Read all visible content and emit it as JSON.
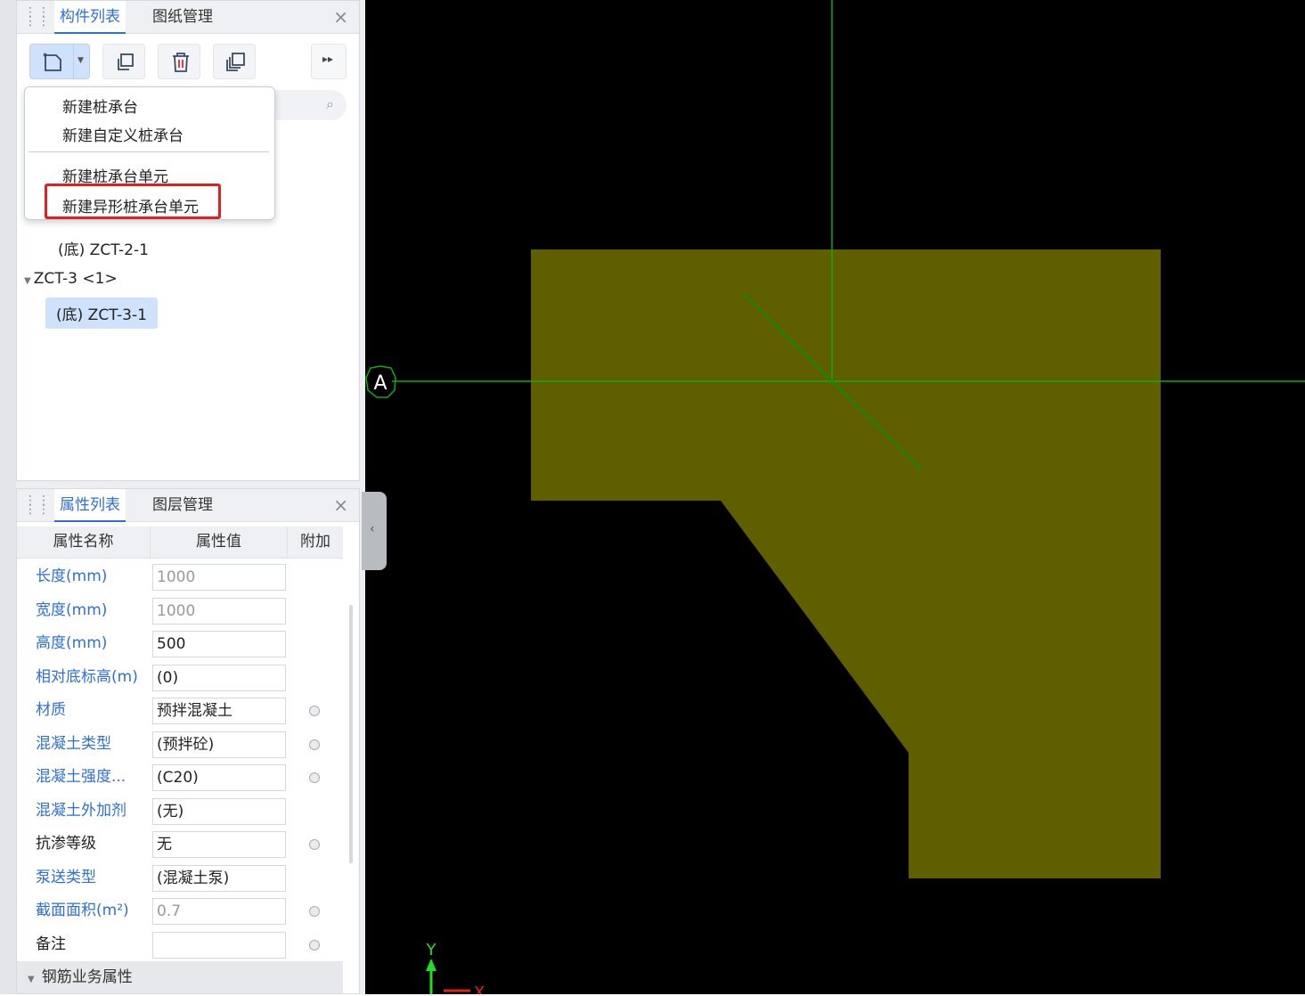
{
  "top_panel": {
    "tabs": [
      "构件列表",
      "图纸管理"
    ],
    "close": "×"
  },
  "dropdown": {
    "items": [
      "新建桩承台",
      "新建自定义桩承台",
      "新建桩承台单元",
      "新建异形桩承台单元"
    ],
    "highlighted": "新建异形桩承台单元"
  },
  "tree": {
    "items": [
      {
        "label": "(底) ZCT-2-1",
        "selected": false
      },
      {
        "label": "ZCT-3 <1>",
        "selected": false
      },
      {
        "label": "(底) ZCT-3-1",
        "selected": true
      }
    ]
  },
  "bottom_panel": {
    "tabs": [
      "属性列表",
      "图层管理"
    ],
    "close": "×",
    "columns": [
      "属性名称",
      "属性值",
      "附加"
    ],
    "rows": [
      {
        "name": "长度(mm)",
        "value": "1000",
        "blue": true,
        "gray": true,
        "radio": false
      },
      {
        "name": "宽度(mm)",
        "value": "1000",
        "blue": true,
        "gray": true,
        "radio": false
      },
      {
        "name": "高度(mm)",
        "value": "500",
        "blue": true,
        "gray": false,
        "radio": false
      },
      {
        "name": "相对底标高(m)",
        "value": "(0)",
        "blue": true,
        "gray": false,
        "radio": false
      },
      {
        "name": "材质",
        "value": "预拌混凝土",
        "blue": true,
        "gray": false,
        "radio": true
      },
      {
        "name": "混凝土类型",
        "value": "(预拌砼)",
        "blue": true,
        "gray": false,
        "radio": true
      },
      {
        "name": "混凝土强度...",
        "value": "(C20)",
        "blue": true,
        "gray": false,
        "radio": true
      },
      {
        "name": "混凝土外加剂",
        "value": "(无)",
        "blue": true,
        "gray": false,
        "radio": false
      },
      {
        "name": "抗渗等级",
        "value": "无",
        "blue": false,
        "gray": false,
        "radio": true
      },
      {
        "name": "泵送类型",
        "value": "(混凝土泵)",
        "blue": true,
        "gray": false,
        "radio": false
      },
      {
        "name": "截面面积(m²)",
        "value": "0.7",
        "blue": true,
        "gray": true,
        "radio": true
      },
      {
        "name": "备注",
        "value": "",
        "blue": false,
        "gray": false,
        "radio": true
      }
    ],
    "group": "钢筋业务属性"
  },
  "canvas": {
    "axis_label": "A",
    "y_axis": "Y",
    "x_axis": "X",
    "shape_color": "#5f5f00",
    "grid_color": "#11aa11"
  }
}
